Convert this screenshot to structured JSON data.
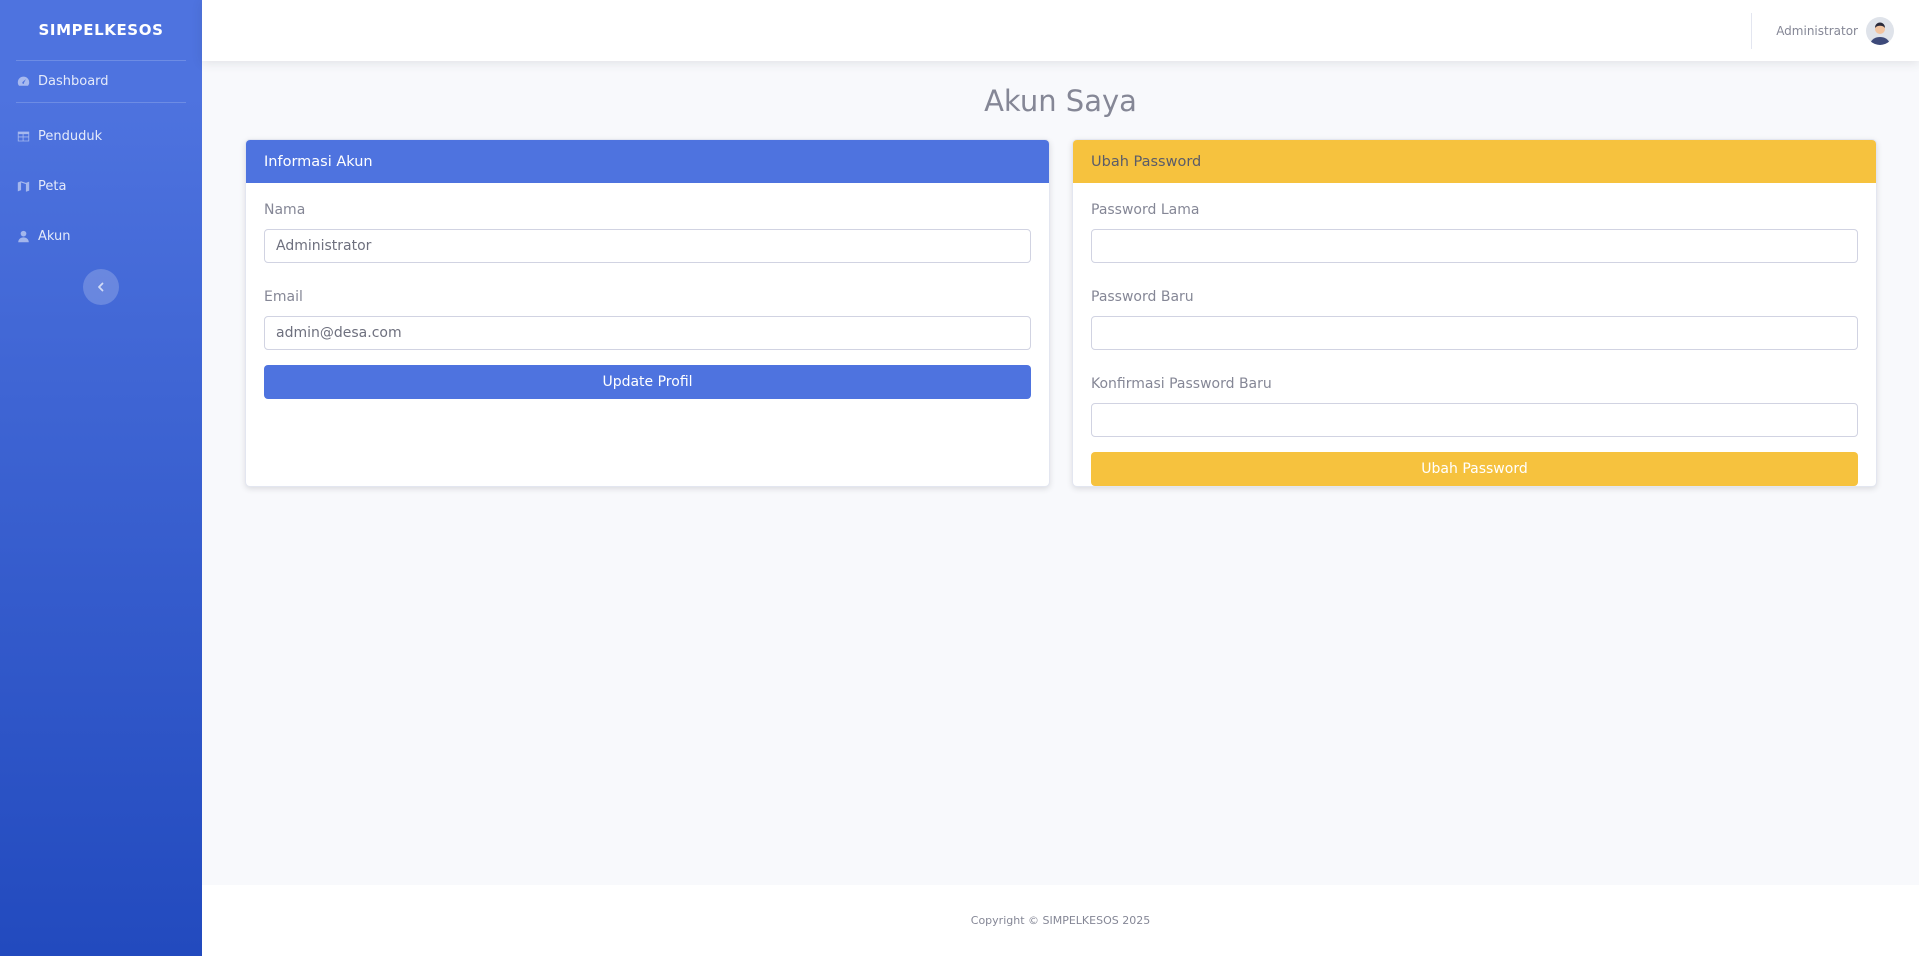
{
  "sidebar": {
    "brand": "SIMPELKESOS",
    "items": [
      {
        "label": "Dashboard",
        "icon": "tachometer-icon"
      },
      {
        "label": "Penduduk",
        "icon": "table-icon"
      },
      {
        "label": "Peta",
        "icon": "map-icon"
      },
      {
        "label": "Akun",
        "icon": "user-icon"
      }
    ],
    "toggle_icon": "chevron-left-icon"
  },
  "topbar": {
    "user_name": "Administrator",
    "avatar_icon": "avatar-icon"
  },
  "page": {
    "title": "Akun Saya"
  },
  "account_card": {
    "header": "Informasi Akun",
    "name_label": "Nama",
    "name_value": "Administrator",
    "email_label": "Email",
    "email_value": "admin@desa.com",
    "submit_label": "Update Profil"
  },
  "password_card": {
    "header": "Ubah Password",
    "old_label": "Password Lama",
    "old_value": "",
    "new_label": "Password Baru",
    "new_value": "",
    "confirm_label": "Konfirmasi Password Baru",
    "confirm_value": "",
    "submit_label": "Ubah Password"
  },
  "footer": {
    "text": "Copyright © SIMPELKESOS 2025"
  },
  "colors": {
    "primary": "#4e73df",
    "warning": "#f6c23e",
    "text_muted": "#858796"
  }
}
